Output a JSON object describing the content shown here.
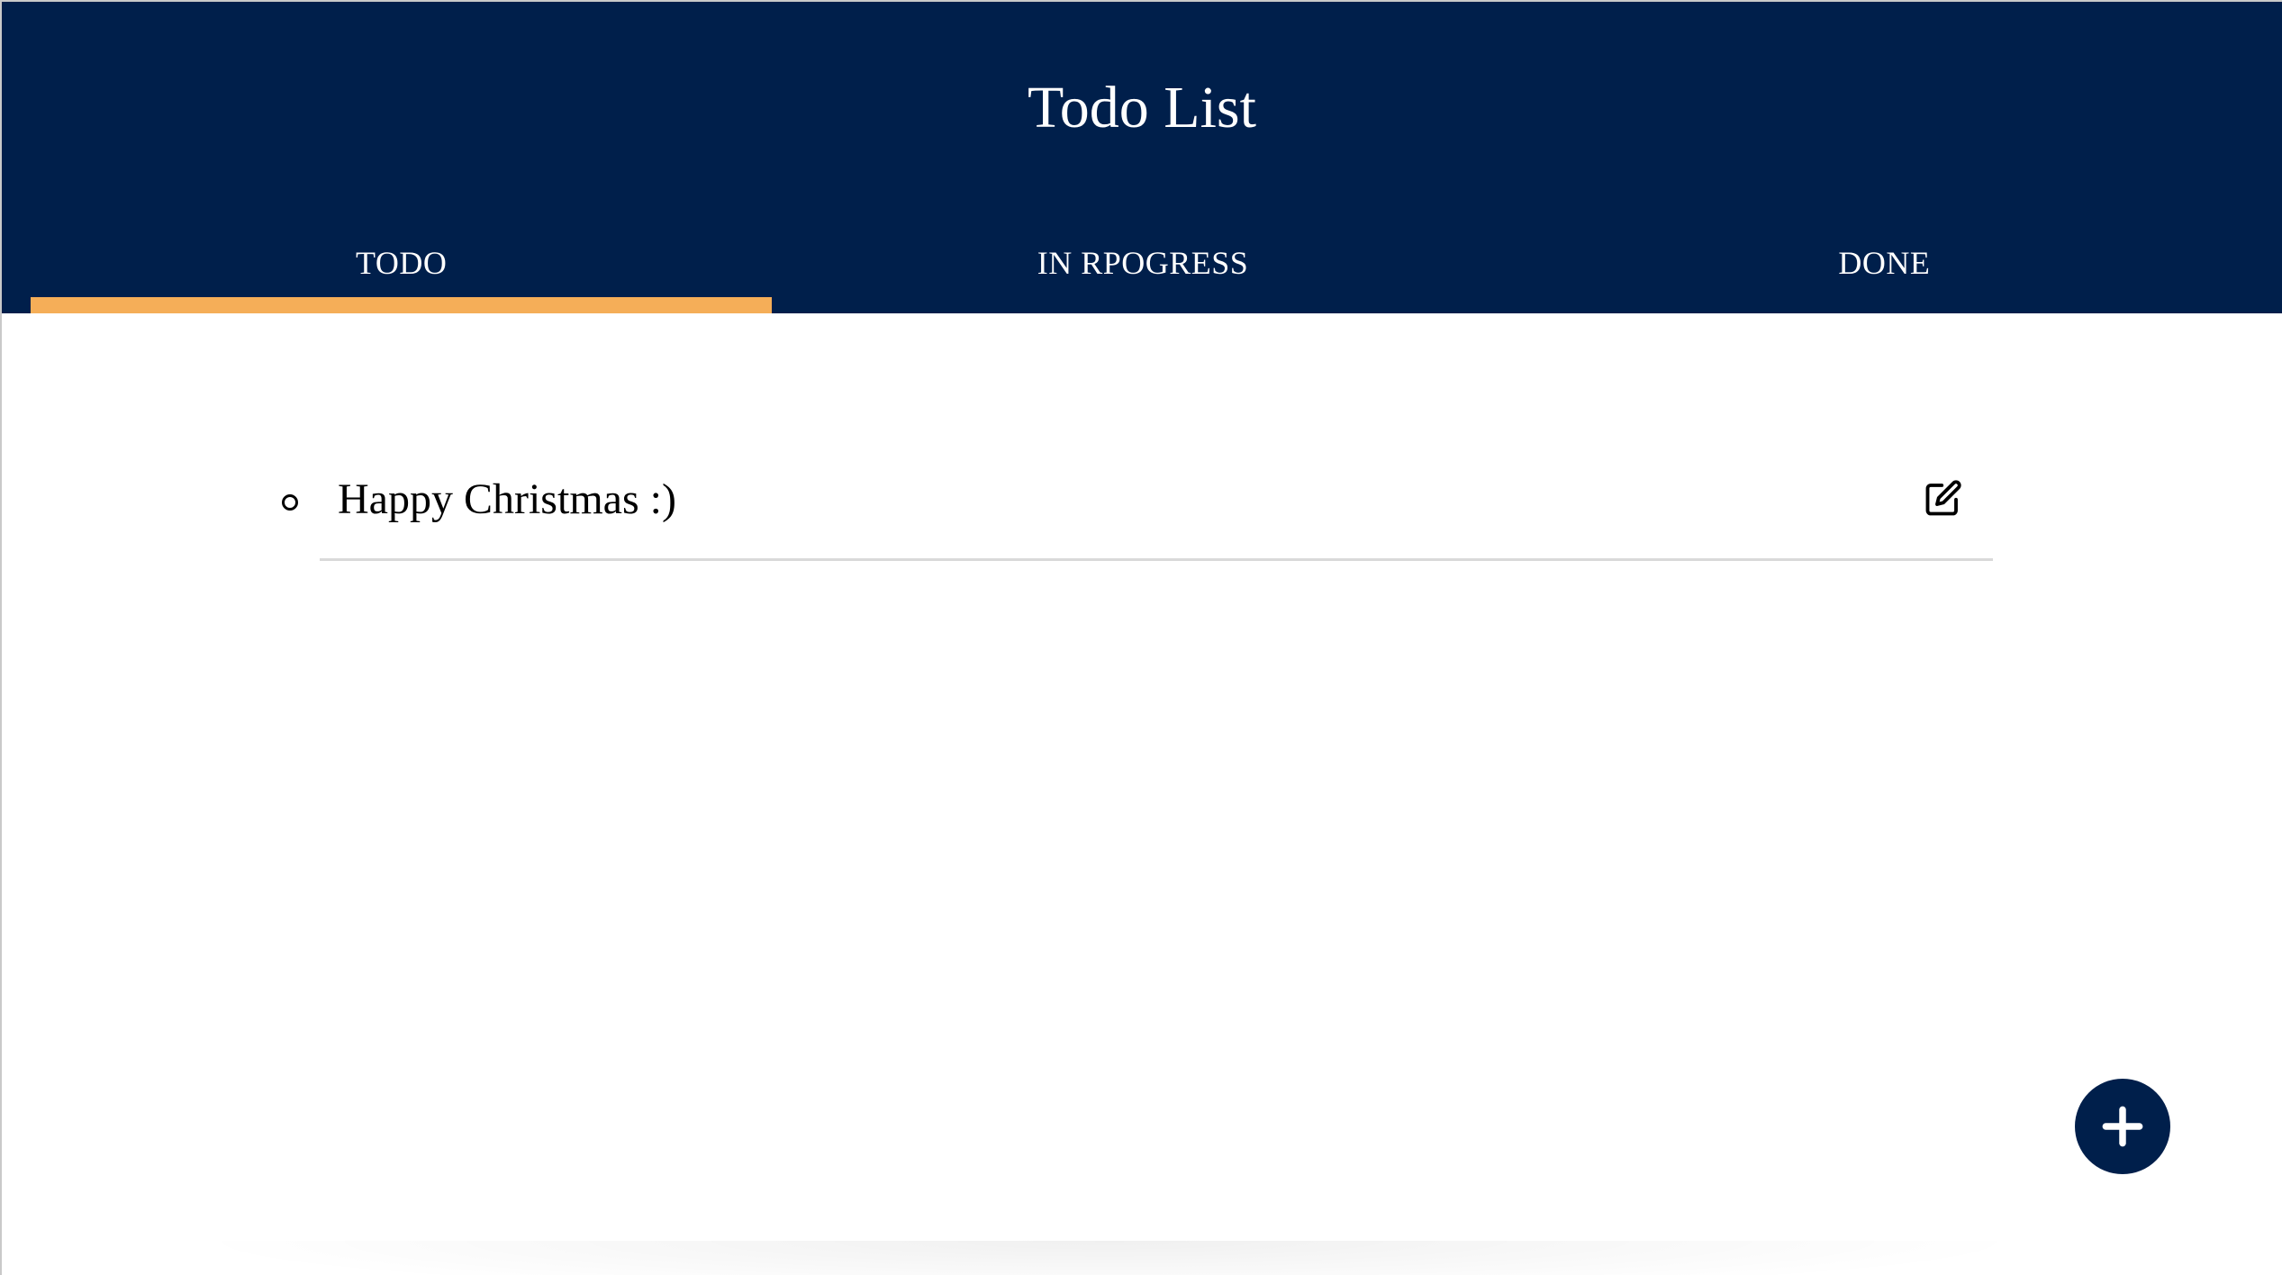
{
  "app": {
    "title": "Todo List"
  },
  "tabs": [
    {
      "label": "TODO",
      "active": true
    },
    {
      "label": "IN RPOGRESS",
      "active": false
    },
    {
      "label": "DONE",
      "active": false
    }
  ],
  "todos": [
    {
      "text": "Happy Christmas :)",
      "edit_icon": "edit-icon"
    }
  ],
  "fab": {
    "icon": "plus-icon"
  },
  "colors": {
    "header_bg": "#001f4b",
    "tab_indicator": "#f5ae58",
    "divider": "#d9d9d9"
  }
}
